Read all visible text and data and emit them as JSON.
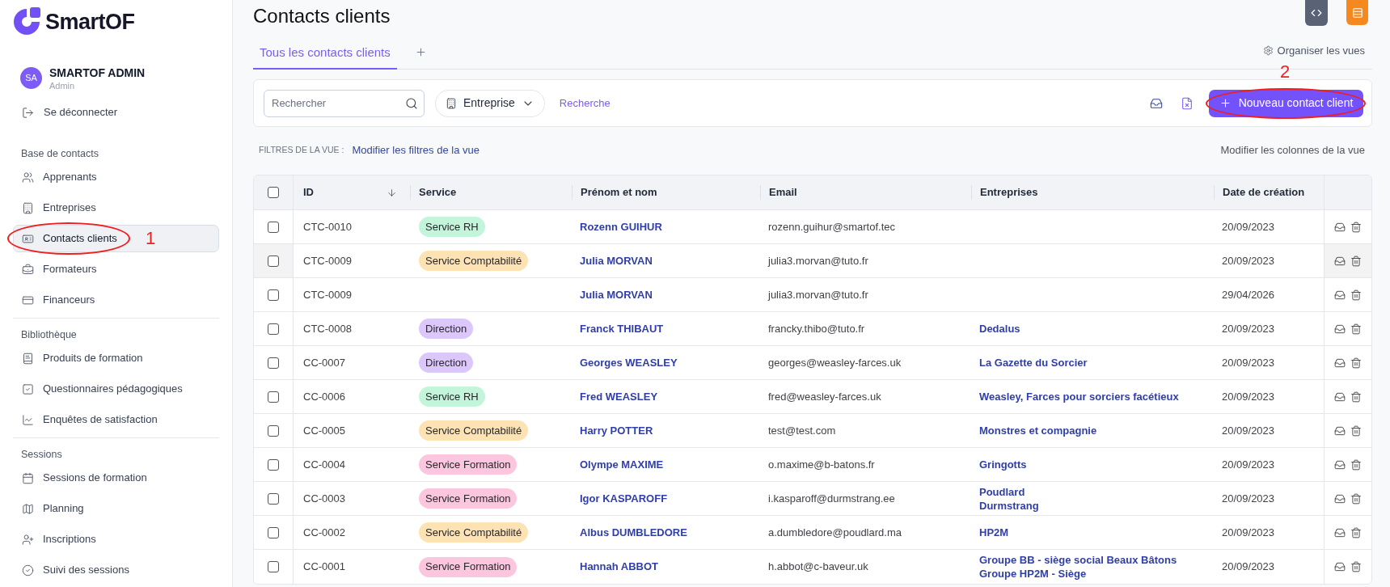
{
  "brand": "SmartOF",
  "user": {
    "initials": "SA",
    "name": "SMARTOF ADMIN",
    "role": "Admin"
  },
  "logout": "Se déconnecter",
  "sidebar": {
    "sections": [
      {
        "title": "Base de contacts",
        "items": [
          {
            "label": "Apprenants",
            "selected": false
          },
          {
            "label": "Entreprises",
            "selected": false
          },
          {
            "label": "Contacts clients",
            "selected": true,
            "annotation": "1"
          },
          {
            "label": "Formateurs",
            "selected": false
          },
          {
            "label": "Financeurs",
            "selected": false
          }
        ]
      },
      {
        "title": "Bibliothèque",
        "items": [
          {
            "label": "Produits de formation",
            "selected": false
          },
          {
            "label": "Questionnaires pédagogiques",
            "selected": false
          },
          {
            "label": "Enquêtes de satisfaction",
            "selected": false
          }
        ]
      },
      {
        "title": "Sessions",
        "items": [
          {
            "label": "Sessions de formation",
            "selected": false
          },
          {
            "label": "Planning",
            "selected": false
          },
          {
            "label": "Inscriptions",
            "selected": false
          },
          {
            "label": "Suivi des sessions",
            "selected": false
          }
        ]
      }
    ]
  },
  "title": "Contacts clients",
  "tabs": [
    {
      "label": "Tous les contacts clients",
      "selected": true
    }
  ],
  "organize_views": "Organiser les vues",
  "toolbar": {
    "search": {
      "placeholder": "Rechercher"
    },
    "filter": {
      "label": "Entreprise"
    },
    "search_link": "Recherche",
    "new_button": {
      "label": "Nouveau contact client",
      "annotation": "2"
    }
  },
  "filters": {
    "label": "FILTRES DE LA VUE :",
    "edit_filters": "Modifier les filtres de la vue",
    "edit_columns": "Modifier les colonnes de la vue"
  },
  "table": {
    "select_all": {
      "checked": false
    },
    "columns": [
      {
        "label": "ID",
        "sorted": true
      },
      {
        "label": "Service",
        "sorted": false
      },
      {
        "label": "Prénom et nom",
        "sorted": false
      },
      {
        "label": "Email",
        "sorted": false
      },
      {
        "label": "Entreprises",
        "sorted": false
      },
      {
        "label": "Date de création",
        "sorted": false
      }
    ],
    "rows": [
      {
        "checked": false,
        "id": "CTC-0010",
        "service": {
          "label": "Service RH",
          "color": "#c3f5da"
        },
        "name": "Rozenn GUIHUR",
        "email": "rozenn.guihur@smartof.tec",
        "created": "20/09/2023",
        "hovered": false
      },
      {
        "checked": false,
        "id": "CTC-0009",
        "service": {
          "label": "Service Comptabilité",
          "color": "#fde3b3"
        },
        "name": "Julia MORVAN",
        "email": "julia3.morvan@tuto.fr",
        "created": "20/09/2023",
        "hovered": true
      },
      {
        "checked": false,
        "id": "CTC-0009",
        "name": "Julia MORVAN",
        "email": "julia3.morvan@tuto.fr",
        "created": "29/04/2026",
        "hovered": false
      },
      {
        "checked": false,
        "id": "CTC-0008",
        "service": {
          "label": "Direction",
          "color": "#dcc7fb"
        },
        "name": "Franck THIBAUT",
        "email": "francky.thibo@tuto.fr",
        "companies": [
          "Dedalus"
        ],
        "created": "20/09/2023",
        "hovered": false
      },
      {
        "checked": false,
        "id": "CC-0007",
        "service": {
          "label": "Direction",
          "color": "#dcc7fb"
        },
        "name": "Georges WEASLEY",
        "email": "georges@weasley-farces.uk",
        "companies": [
          "La Gazette du Sorcier"
        ],
        "created": "20/09/2023",
        "hovered": false
      },
      {
        "checked": false,
        "id": "CC-0006",
        "service": {
          "label": "Service RH",
          "color": "#c3f5da"
        },
        "name": "Fred WEASLEY",
        "email": "fred@weasley-farces.uk",
        "companies": [
          "Weasley, Farces pour sorciers facétieux"
        ],
        "created": "20/09/2023",
        "hovered": false
      },
      {
        "checked": false,
        "id": "CC-0005",
        "service": {
          "label": "Service Comptabilité",
          "color": "#fde3b3"
        },
        "name": "Harry POTTER",
        "email": "test@test.com",
        "companies": [
          "Monstres et compagnie"
        ],
        "created": "20/09/2023",
        "hovered": false
      },
      {
        "checked": false,
        "id": "CC-0004",
        "service": {
          "label": "Service Formation",
          "color": "#fcc6df"
        },
        "name": "Olympe MAXIME",
        "email": "o.maxime@b-batons.fr",
        "companies": [
          "Gringotts"
        ],
        "created": "20/09/2023",
        "hovered": false
      },
      {
        "checked": false,
        "id": "CC-0003",
        "service": {
          "label": "Service Formation",
          "color": "#fcc6df"
        },
        "name": "Igor KASPAROFF",
        "email": "i.kasparoff@durmstrang.ee",
        "companies": [
          "Poudlard",
          "Durmstrang"
        ],
        "created": "20/09/2023",
        "hovered": false
      },
      {
        "checked": false,
        "id": "CC-0002",
        "service": {
          "label": "Service Comptabilité",
          "color": "#fde3b3"
        },
        "name": "Albus DUMBLEDORE",
        "email": "a.dumbledore@poudlard.ma",
        "companies": [
          "HP2M"
        ],
        "created": "20/09/2023",
        "hovered": false
      },
      {
        "checked": false,
        "id": "CC-0001",
        "service": {
          "label": "Service Formation",
          "color": "#fcc6df"
        },
        "name": "Hannah ABBOT",
        "email": "h.abbot@c-baveur.uk",
        "companies": [
          "Groupe BB - siège social Beaux Bâtons",
          "Groupe HP2M - Siège"
        ],
        "created": "20/09/2023",
        "hovered": false
      }
    ]
  }
}
